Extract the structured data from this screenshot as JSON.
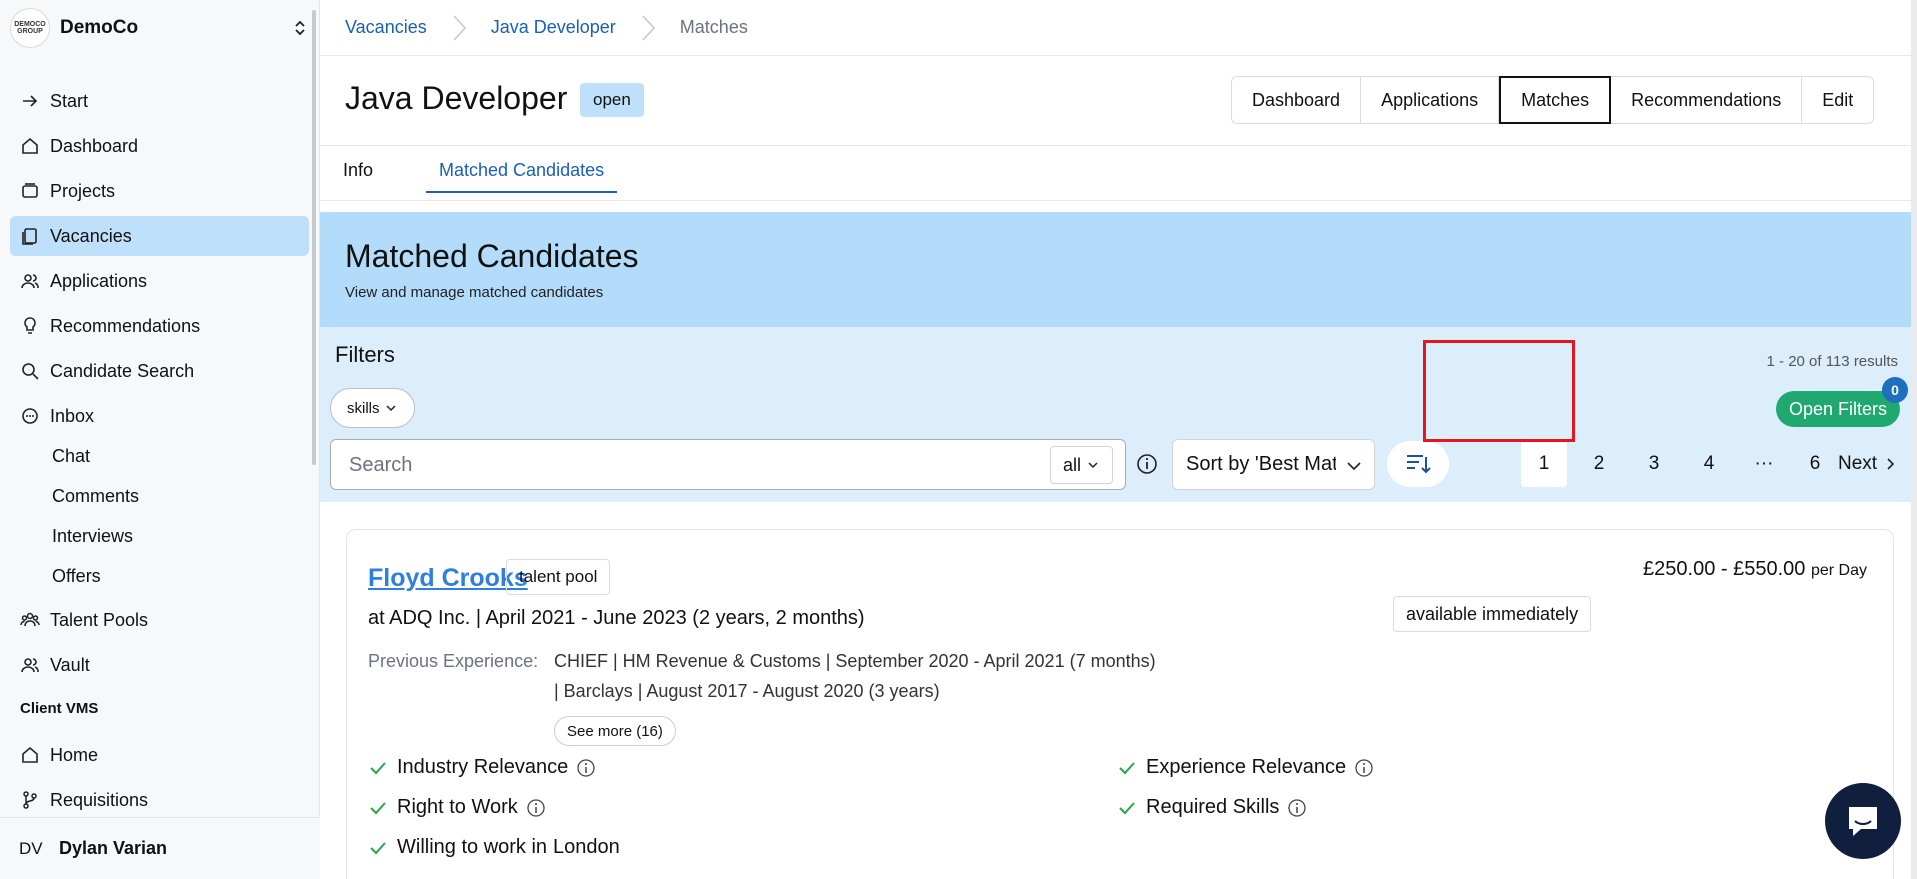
{
  "org": {
    "name": "DemoCo",
    "logo_text": "DEMOCO GROUP"
  },
  "sidebar": {
    "items": [
      {
        "label": "Start",
        "icon": "arrow-right-icon"
      },
      {
        "label": "Dashboard",
        "icon": "home-icon"
      },
      {
        "label": "Projects",
        "icon": "stack-icon"
      },
      {
        "label": "Vacancies",
        "icon": "clipboard-icon",
        "active": true
      },
      {
        "label": "Applications",
        "icon": "users-icon"
      },
      {
        "label": "Recommendations",
        "icon": "lightbulb-icon"
      },
      {
        "label": "Candidate Search",
        "icon": "search-icon"
      },
      {
        "label": "Inbox",
        "icon": "chat-icon"
      }
    ],
    "inbox_sub": [
      "Chat",
      "Comments",
      "Interviews",
      "Offers"
    ],
    "more_items": [
      {
        "label": "Talent Pools",
        "icon": "users-group-icon"
      },
      {
        "label": "Vault",
        "icon": "users-icon"
      }
    ],
    "section_title": "Client VMS",
    "vms_items": [
      {
        "label": "Home",
        "icon": "home-icon"
      },
      {
        "label": "Requisitions",
        "icon": "branch-icon"
      }
    ],
    "user": {
      "initials": "DV",
      "name": "Dylan Varian"
    }
  },
  "breadcrumb": [
    "Vacancies",
    "Java Developer",
    "Matches"
  ],
  "vacancy": {
    "title": "Java Developer",
    "status": "open"
  },
  "header_buttons": [
    "Dashboard",
    "Applications",
    "Matches",
    "Recommendations",
    "Edit"
  ],
  "tabs": [
    "Info",
    "Matched Candidates"
  ],
  "hero": {
    "title": "Matched Candidates",
    "subtitle": "View and manage matched candidates"
  },
  "filters": {
    "title": "Filters",
    "skills_chip": "skills",
    "results_text": "1 - 20 of 113 results",
    "open_filters_label": "Open Filters",
    "open_filters_count": "0",
    "search_placeholder": "Search",
    "search_value": "",
    "scope": "all",
    "sort_label": "Sort by 'Best Match'",
    "pages": [
      "1",
      "2",
      "3",
      "4",
      "···",
      "6"
    ],
    "current_page": "1",
    "next_label": "Next"
  },
  "candidate": {
    "name": "Floyd Crooks",
    "badge": "talent pool",
    "current_job": "at ADQ Inc. | April 2021 - June 2023 (2 years, 2 months)",
    "prev_label": "Previous Experience:",
    "prev_lines": [
      "CHIEF | HM Revenue & Customs | September 2020 - April 2021 (7 months)",
      "| Barclays | August 2017 - August 2020 (3 years)"
    ],
    "see_more": "See more (16)",
    "rate": "£250.00 - £550.00",
    "rate_unit": "per Day",
    "availability": "available immediately",
    "criteria": {
      "industry": "Industry Relevance",
      "experience": "Experience Relevance",
      "rtw": "Right to Work",
      "skills": "Required Skills",
      "willing_prefix": "Willing to work in",
      "willing_city": "London"
    }
  }
}
